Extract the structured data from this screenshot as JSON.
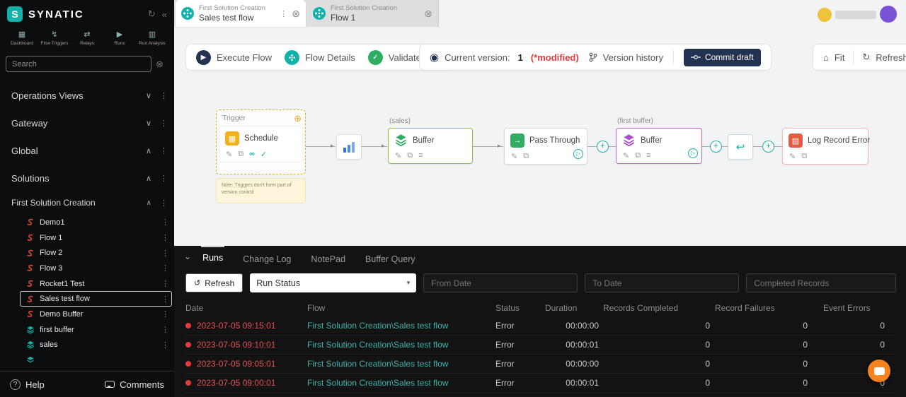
{
  "brand": {
    "name": "SYNATIC"
  },
  "sidebar": {
    "nav_items": [
      {
        "label": "Dashboard",
        "icon": "dashboard-icon"
      },
      {
        "label": "Flow Triggers",
        "icon": "flow-triggers-icon"
      },
      {
        "label": "Relays",
        "icon": "relays-icon"
      },
      {
        "label": "Runs",
        "icon": "runs-icon"
      },
      {
        "label": "Run Analysis",
        "icon": "run-analysis-icon"
      }
    ],
    "search": {
      "placeholder": "Search"
    },
    "sections": [
      {
        "label": "Operations Views",
        "state": "collapsed"
      },
      {
        "label": "Gateway",
        "state": "collapsed"
      },
      {
        "label": "Global",
        "state": "expanded"
      },
      {
        "label": "Solutions",
        "state": "expanded"
      }
    ],
    "solution": {
      "label": "First Solution Creation",
      "state": "expanded"
    },
    "flows": [
      {
        "label": "Demo1",
        "icon": "flow-red"
      },
      {
        "label": "Flow 1",
        "icon": "flow-red"
      },
      {
        "label": "Flow 2",
        "icon": "flow-red"
      },
      {
        "label": "Flow 3",
        "icon": "flow-red"
      },
      {
        "label": "Rocket1 Test",
        "icon": "flow-red"
      },
      {
        "label": "Sales test flow",
        "icon": "flow-red",
        "selected": true
      },
      {
        "label": "Demo Buffer",
        "icon": "flow-red"
      },
      {
        "label": "first buffer",
        "icon": "buffer-teal"
      },
      {
        "label": "sales",
        "icon": "buffer-teal"
      }
    ],
    "footer": {
      "help": "Help",
      "comments": "Comments"
    }
  },
  "tabs": [
    {
      "solution": "First Solution Creation",
      "flow": "Sales test flow",
      "active": true
    },
    {
      "solution": "First Solution Creation",
      "flow": "Flow 1",
      "active": false
    }
  ],
  "toolbar": {
    "execute_label": "Execute Flow",
    "details_label": "Flow Details",
    "validate_label": "Validate Flow",
    "version_label": "Current version:",
    "version_value": "1",
    "version_modified": "(*modified)",
    "history_label": "Version history",
    "commit_label": "Commit draft",
    "fit_label": "Fit",
    "refresh_label": "Refresh"
  },
  "canvas": {
    "trigger_group": {
      "label": "Trigger",
      "node_label": "Schedule",
      "note": "Note: Triggers don't form part of version control"
    },
    "buffer_sales": {
      "group": "(sales)",
      "label": "Buffer"
    },
    "pass_through": {
      "label": "Pass Through"
    },
    "buffer_first": {
      "group": "(first buffer)",
      "label": "Buffer"
    },
    "log_error": {
      "label": "Log Record Error"
    }
  },
  "runs_panel": {
    "tabs": [
      {
        "label": "Runs",
        "active": true
      },
      {
        "label": "Change Log",
        "active": false
      },
      {
        "label": "NotePad",
        "active": false
      },
      {
        "label": "Buffer Query",
        "active": false
      }
    ],
    "filters": {
      "refresh_label": "Refresh",
      "run_status_value": "Run Status",
      "from_date_placeholder": "From Date",
      "to_date_placeholder": "To Date",
      "completed_records_placeholder": "Completed Records"
    },
    "columns": [
      "Date",
      "Flow",
      "Status",
      "Duration",
      "Records Completed",
      "Record Failures",
      "Event Errors"
    ],
    "rows": [
      {
        "date": "2023-07-05 09:15:01",
        "flow": "First Solution Creation\\Sales test flow",
        "status": "Error",
        "duration": "00:00:00",
        "records_completed": "0",
        "record_failures": "0",
        "event_errors": "0"
      },
      {
        "date": "2023-07-05 09:10:01",
        "flow": "First Solution Creation\\Sales test flow",
        "status": "Error",
        "duration": "00:00:01",
        "records_completed": "0",
        "record_failures": "0",
        "event_errors": "0"
      },
      {
        "date": "2023-07-05 09:05:01",
        "flow": "First Solution Creation\\Sales test flow",
        "status": "Error",
        "duration": "00:00:00",
        "records_completed": "0",
        "record_failures": "0",
        "event_errors": "0"
      },
      {
        "date": "2023-07-05 09:00:01",
        "flow": "First Solution Creation\\Sales test flow",
        "status": "Error",
        "duration": "00:00:01",
        "records_completed": "0",
        "record_failures": "0",
        "event_errors": "0"
      }
    ]
  },
  "colors": {
    "accent_teal": "#14b1ab",
    "error_red": "#e25050",
    "navy": "#223250",
    "orange_fab": "#f5841f",
    "trigger_amber": "#e2aa2e",
    "buffer_green": "#2fae63",
    "buffer_purple": "#a84fc9"
  }
}
